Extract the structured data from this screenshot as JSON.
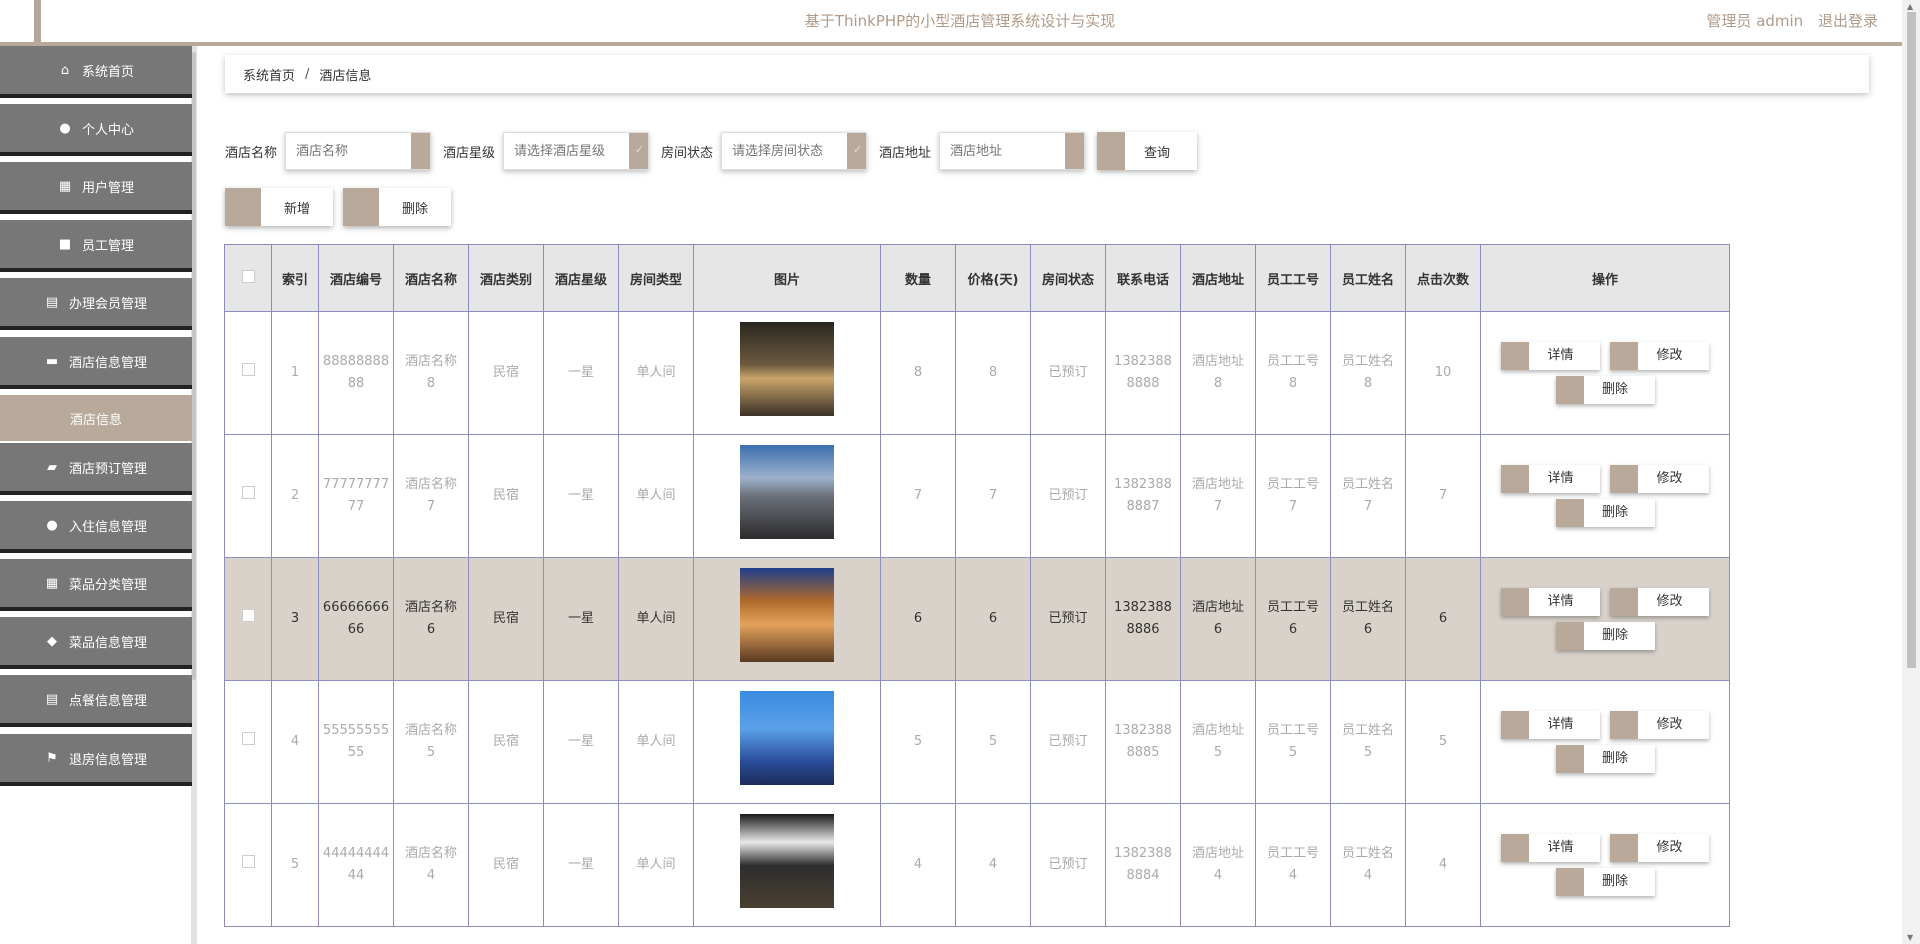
{
  "header": {
    "title": "基于ThinkPHP的小型酒店管理系统设计与实现",
    "user": "管理员 admin",
    "logout": "退出登录"
  },
  "sidebar": {
    "items": [
      {
        "label": "系统首页",
        "icon": "home-icon",
        "glyph": "⌂"
      },
      {
        "label": "个人中心",
        "icon": "person-icon",
        "glyph": "●"
      },
      {
        "label": "用户管理",
        "icon": "grid-icon",
        "glyph": "▦"
      },
      {
        "label": "员工管理",
        "icon": "briefcase-icon",
        "glyph": "■"
      },
      {
        "label": "办理会员管理",
        "icon": "clipboard-icon",
        "glyph": "▤"
      },
      {
        "label": "酒店信息管理",
        "icon": "ticket-icon",
        "glyph": "▬"
      },
      {
        "label": "酒店预订管理",
        "icon": "wallet-icon",
        "glyph": "▰"
      },
      {
        "label": "入住信息管理",
        "icon": "user-icon",
        "glyph": "●"
      },
      {
        "label": "菜品分类管理",
        "icon": "grid-icon",
        "glyph": "▦"
      },
      {
        "label": "菜品信息管理",
        "icon": "bulb-icon",
        "glyph": "◆"
      },
      {
        "label": "点餐信息管理",
        "icon": "clipboard-check-icon",
        "glyph": "▤"
      },
      {
        "label": "退房信息管理",
        "icon": "flag-icon",
        "glyph": "⚑"
      }
    ],
    "active_sub": "酒店信息"
  },
  "breadcrumb": {
    "home": "系统首页",
    "sep": "/",
    "current": "酒店信息"
  },
  "filters": {
    "name_label": "酒店名称",
    "name_placeholder": "酒店名称",
    "star_label": "酒店星级",
    "star_placeholder": "请选择酒店星级",
    "status_label": "房间状态",
    "status_placeholder": "请选择房间状态",
    "addr_label": "酒店地址",
    "addr_placeholder": "酒店地址",
    "query": "查询"
  },
  "actions": {
    "add": "新增",
    "delete": "删除"
  },
  "table": {
    "headers": [
      "索引",
      "酒店编号",
      "酒店名称",
      "酒店类别",
      "酒店星级",
      "房间类型",
      "图片",
      "数量",
      "价格(天)",
      "房间状态",
      "联系电话",
      "酒店地址",
      "员工工号",
      "员工姓名",
      "点击次数",
      "操作"
    ],
    "row_buttons": {
      "detail": "详情",
      "edit": "修改",
      "delete": "删除"
    },
    "rows": [
      {
        "idx": "1",
        "code": "8888888888",
        "name": "酒店名称8",
        "type": "民宿",
        "star": "一星",
        "room": "单人间",
        "qty": "8",
        "price": "8",
        "status": "已预订",
        "phone": "13823888888",
        "addr": "酒店地址8",
        "staff_no": "员工工号8",
        "staff_name": "员工姓名8",
        "clicks": "10",
        "img": "night-hotel-photo"
      },
      {
        "idx": "2",
        "code": "7777777777",
        "name": "酒店名称7",
        "type": "民宿",
        "star": "一星",
        "room": "单人间",
        "qty": "7",
        "price": "7",
        "status": "已预订",
        "phone": "13823888887",
        "addr": "酒店地址7",
        "staff_no": "员工工号7",
        "staff_name": "员工姓名7",
        "clicks": "7",
        "img": "hotel-entrance-photo"
      },
      {
        "idx": "3",
        "code": "6666666666",
        "name": "酒店名称6",
        "type": "民宿",
        "star": "一星",
        "room": "单人间",
        "qty": "6",
        "price": "6",
        "status": "已预订",
        "phone": "13823888886",
        "addr": "酒店地址6",
        "staff_no": "员工工号6",
        "staff_name": "员工姓名6",
        "clicks": "6",
        "img": "lobby-photo"
      },
      {
        "idx": "4",
        "code": "5555555555",
        "name": "酒店名称5",
        "type": "民宿",
        "star": "一星",
        "room": "单人间",
        "qty": "5",
        "price": "5",
        "status": "已预订",
        "phone": "13823888885",
        "addr": "酒店地址5",
        "staff_no": "员工工号5",
        "staff_name": "员工姓名5",
        "clicks": "5",
        "img": "tower-photo"
      },
      {
        "idx": "5",
        "code": "4444444444",
        "name": "酒店名称4",
        "type": "民宿",
        "star": "一星",
        "room": "单人间",
        "qty": "4",
        "price": "4",
        "status": "已预订",
        "phone": "13823888884",
        "addr": "酒店地址4",
        "staff_no": "员工工号4",
        "staff_name": "员工姓名4",
        "clicks": "4",
        "img": "storefront-photo"
      }
    ]
  },
  "colors": {
    "accent": "#b8a99a",
    "menu_bg": "#777777",
    "highlight_row": "#d9d2cb",
    "table_border": "#8c8cbf"
  }
}
